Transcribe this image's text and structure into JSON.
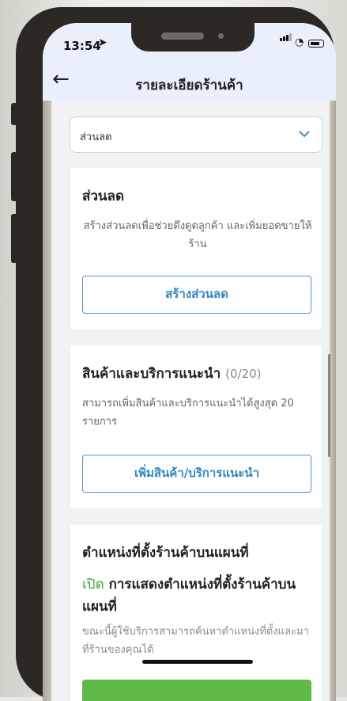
{
  "status_bar": {
    "time": "13:54",
    "location_icon": "location-arrow-icon",
    "signal_icon": "cellular-signal-icon",
    "wifi_icon": "wifi-icon",
    "battery_icon": "battery-icon"
  },
  "app_bar": {
    "back_icon": "back-arrow-icon",
    "title": "รายละเอียดร้านค้า"
  },
  "section_select": {
    "selected_value": "ส่วนลด",
    "icon": "chevron-down-icon"
  },
  "discount_card": {
    "title": "ส่วนลด",
    "description": "สร้างส่วนลดเพื่อช่วยดึงดูดลูกค้า และเพิ่มยอดขายให้ร้าน",
    "button_label": "สร้างส่วนลด"
  },
  "recommended_card": {
    "title": "สินค้าและบริการแนะนำ",
    "count": "(0/20)",
    "description": "สามารถเพิ่มสินค้าและบริการแนะนำได้สูงสุด 20 รายการ",
    "button_label": "เพิ่มสินค้า/บริการแนะนำ"
  },
  "map_card": {
    "title": "ตำแหน่งที่ตั้งร้านค้าบนแผนที่",
    "status": "เปิด",
    "setting_label": "การแสดงตำแหน่งที่ตั้งร้านค้าบนแผนที่",
    "description": "ขณะนี้ผู้ใช้บริการสามารถค้นหาตำแหน่งที่ตั้งและมาที่ร้านของคุณได้"
  },
  "colors": {
    "accent_blue": "#2f88c2",
    "status_green": "#3fa535",
    "header_bg": "#e9f0fb"
  }
}
